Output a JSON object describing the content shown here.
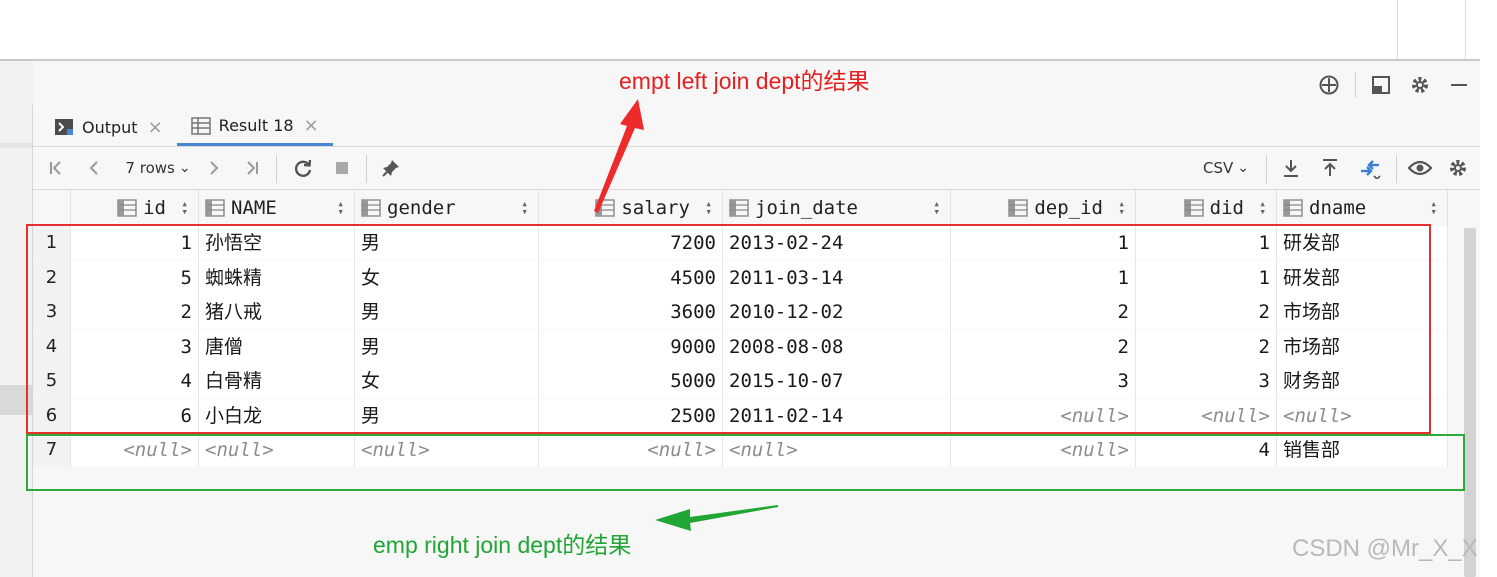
{
  "annotations": {
    "top_note": "empt left join dept的结果",
    "bottom_note": "emp right join dept的结果",
    "top_color": "#e62020",
    "bottom_color": "#21a535"
  },
  "tabs": [
    {
      "label": "Output",
      "icon": "console-icon",
      "close": "×"
    },
    {
      "label": "Result 18",
      "icon": "table-icon",
      "close": "×"
    }
  ],
  "toolbar": {
    "rows_label": "7 rows",
    "export_format": "CSV",
    "dropdown_glyph": "⌄"
  },
  "columns": [
    "id",
    "NAME",
    "gender",
    "salary",
    "join_date",
    "dep_id",
    "did",
    "dname"
  ],
  "rows": [
    [
      "1",
      "1",
      "孙悟空",
      "男",
      "7200",
      "2013-02-24",
      "1",
      "1",
      "研发部"
    ],
    [
      "2",
      "5",
      "蜘蛛精",
      "女",
      "4500",
      "2011-03-14",
      "1",
      "1",
      "研发部"
    ],
    [
      "3",
      "2",
      "猪八戒",
      "男",
      "3600",
      "2010-12-02",
      "2",
      "2",
      "市场部"
    ],
    [
      "4",
      "3",
      "唐僧",
      "男",
      "9000",
      "2008-08-08",
      "2",
      "2",
      "市场部"
    ],
    [
      "5",
      "4",
      "白骨精",
      "女",
      "5000",
      "2015-10-07",
      "3",
      "3",
      "财务部"
    ],
    [
      "6",
      "6",
      "小白龙",
      "男",
      "2500",
      "2011-02-14",
      "<null>",
      "<null>",
      "<null>"
    ],
    [
      "7",
      "<null>",
      "<null>",
      "<null>",
      "<null>",
      "<null>",
      "<null>",
      "4",
      "销售部"
    ]
  ],
  "watermark": "CSDN @Mr_X_X"
}
